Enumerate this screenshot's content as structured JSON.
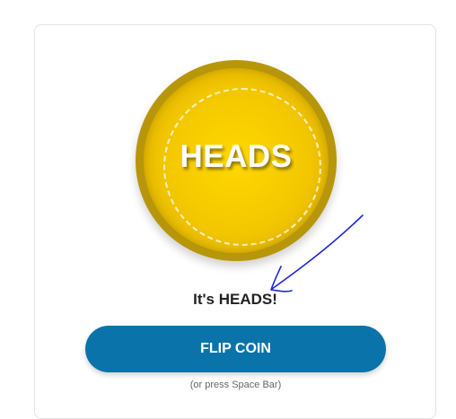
{
  "coin": {
    "face_label": "HEADS",
    "colors": {
      "rim": "#b8960a",
      "face": "#ffd800"
    }
  },
  "result": {
    "text": "It's HEADS!"
  },
  "flip_button": {
    "label": "FLIP COIN",
    "color": "#0a73aa"
  },
  "hint": {
    "text": "(or press Space Bar)"
  },
  "annotation": {
    "icon": "hand-drawn-arrow-icon",
    "color": "#1c28d6"
  }
}
